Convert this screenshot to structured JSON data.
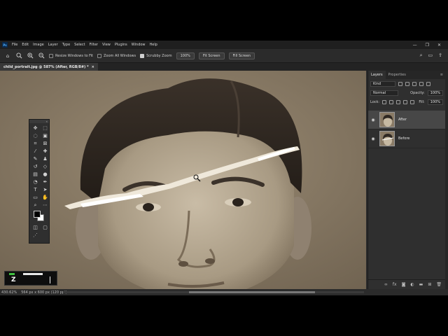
{
  "menubar": {
    "logo": "Ps",
    "items": [
      "File",
      "Edit",
      "Image",
      "Layer",
      "Type",
      "Select",
      "Filter",
      "View",
      "Plugins",
      "Window",
      "Help"
    ],
    "minimize": "—",
    "restore": "❐",
    "close": "✕"
  },
  "options": {
    "resize_windows": "Resize Windows to Fit",
    "zoom_all": "Zoom All Windows",
    "scrubby_zoom": "Scrubby Zoom",
    "zoom_value": "100%",
    "fit_screen": "Fit Screen",
    "fill_screen": "Fill Screen",
    "resize_windows_checked": false,
    "zoom_all_checked": false,
    "scrubby_zoom_checked": true
  },
  "document": {
    "tab_title": "child_portrait.jpg @ 587% (After, RGB/8#) *",
    "close_symbol": "×"
  },
  "status": {
    "zoom": "430.62%",
    "doc_info": "564 px x 600 px (120 ppi)",
    "arrow": "›"
  },
  "keycast": {
    "key": "Z"
  },
  "layers_panel": {
    "tabs": [
      "Layers",
      "Properties"
    ],
    "filter_kind": "Kind",
    "blend_mode": "Normal",
    "opacity_label": "Opacity:",
    "opacity_value": "100%",
    "lock_label": "Lock:",
    "fill_label": "Fill:",
    "fill_value": "100%",
    "layers": [
      {
        "name": "After",
        "visible": true,
        "selected": true
      },
      {
        "name": "Before",
        "visible": true,
        "selected": false
      }
    ]
  },
  "colors": {
    "foreground": "#000000",
    "background": "#ffffff",
    "ui_dark": "#2b2b2b",
    "selection": "#474747"
  }
}
